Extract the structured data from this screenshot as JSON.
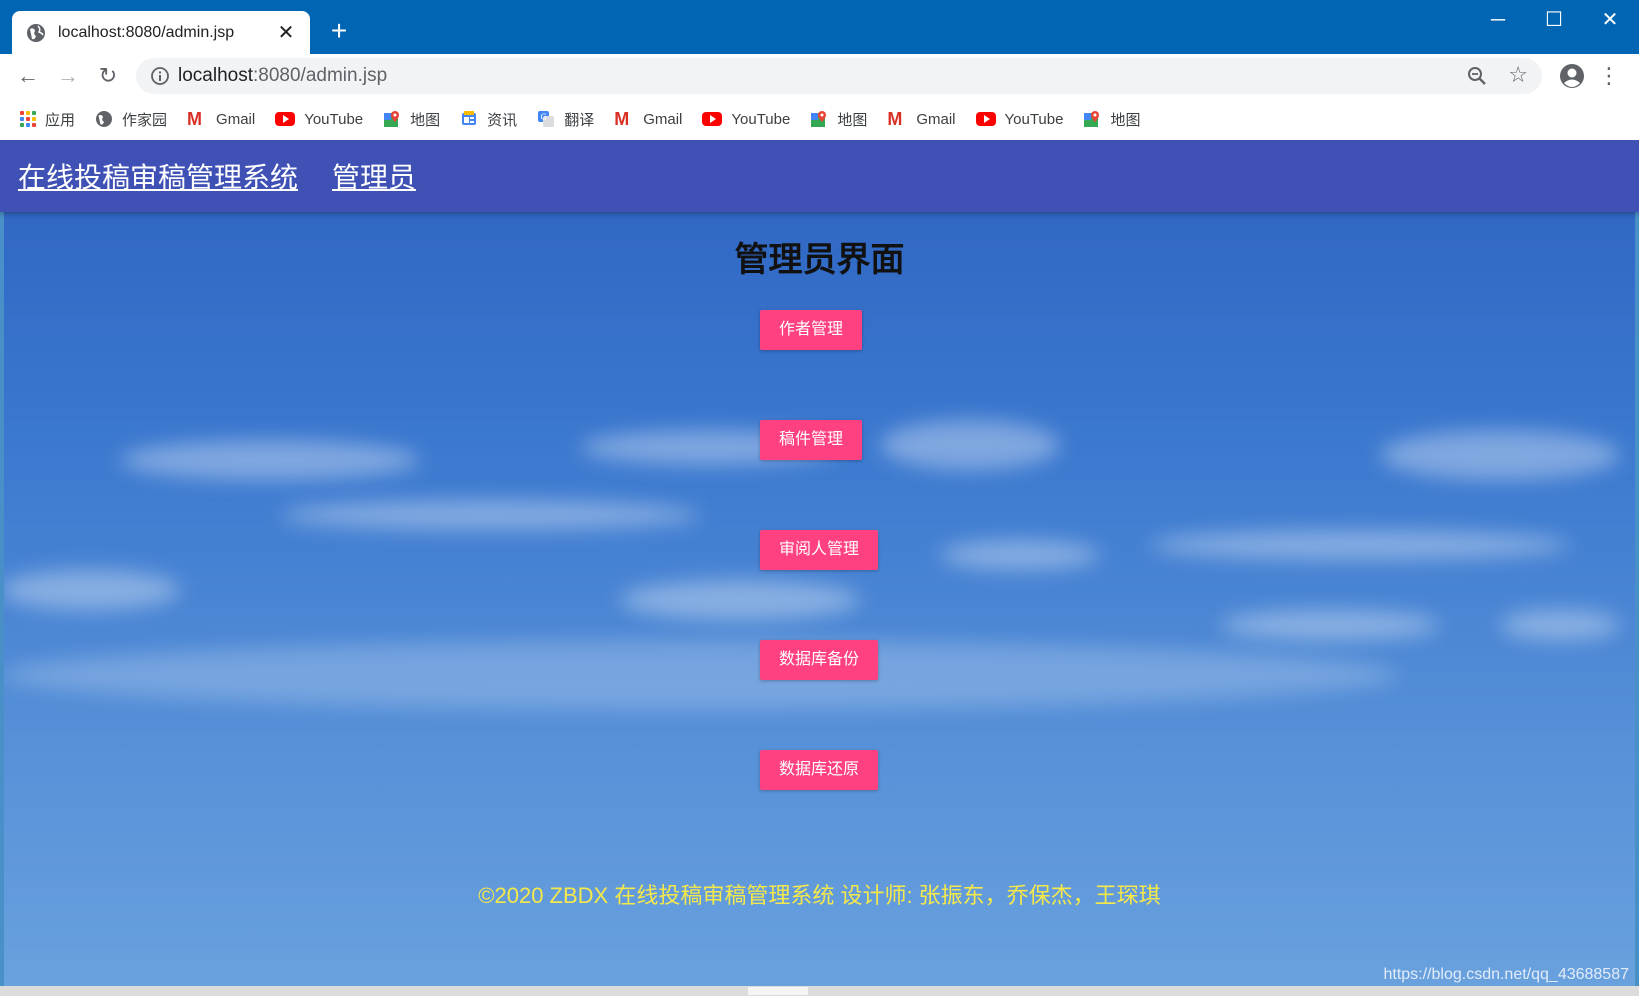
{
  "browser": {
    "tab_title": "localhost:8080/admin.jsp",
    "tab_close": "✕",
    "new_tab": "+",
    "url_host": "localhost",
    "url_rest": ":8080/admin.jsp",
    "minimize": "─",
    "maximize": "☐",
    "close": "✕",
    "bookmarks": [
      {
        "label": "应用",
        "icon": "apps-icon"
      },
      {
        "label": "作家园",
        "icon": "globe-icon"
      },
      {
        "label": "Gmail",
        "icon": "gmail-icon"
      },
      {
        "label": "YouTube",
        "icon": "youtube-icon"
      },
      {
        "label": "地图",
        "icon": "maps-icon"
      },
      {
        "label": "资讯",
        "icon": "news-icon"
      },
      {
        "label": "翻译",
        "icon": "translate-icon"
      },
      {
        "label": "Gmail",
        "icon": "gmail-icon"
      },
      {
        "label": "YouTube",
        "icon": "youtube-icon"
      },
      {
        "label": "地图",
        "icon": "maps-icon"
      },
      {
        "label": "Gmail",
        "icon": "gmail-icon"
      },
      {
        "label": "YouTube",
        "icon": "youtube-icon"
      },
      {
        "label": "地图",
        "icon": "maps-icon"
      }
    ]
  },
  "navbar": {
    "brand": "在线投稿审稿管理系统",
    "role": "管理员"
  },
  "main": {
    "heading": "管理员界面",
    "buttons": [
      "作者管理",
      "稿件管理",
      "审阅人管理",
      "数据库备份",
      "数据库还原"
    ]
  },
  "footer": {
    "text": "©2020 ZBDX 在线投稿审稿管理系统 设计师: 张振东，乔保杰，王琛琪"
  },
  "watermark": "https://blog.csdn.net/qq_43688587",
  "colors": {
    "chrome_blue": "#0065b3",
    "navbar": "#3f51b5",
    "button": "#ff4081",
    "footer_text": "#f5e84a"
  }
}
